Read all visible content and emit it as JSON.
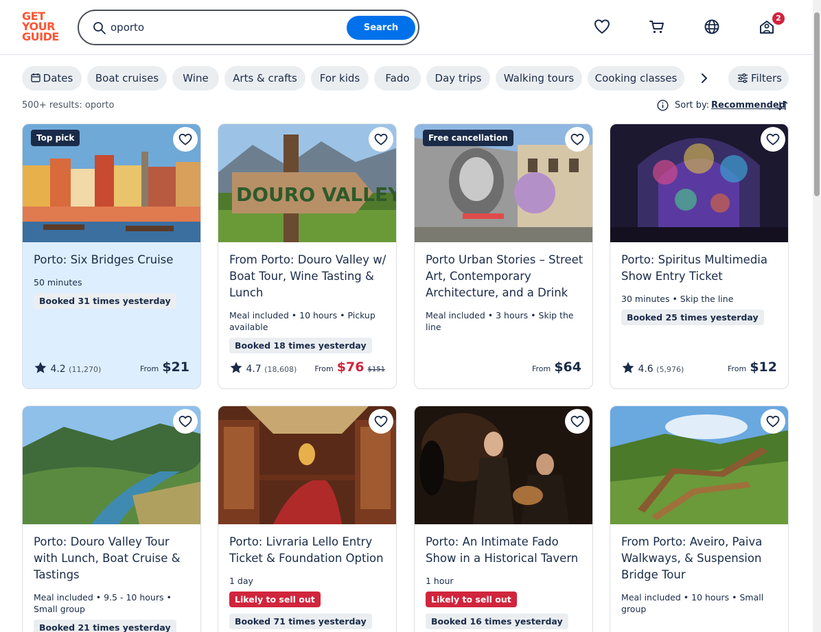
{
  "header": {
    "logo_lines": [
      "GET",
      "YOUR",
      "GUIDE"
    ],
    "search_value": "oporto",
    "search_button": "Search",
    "cart_badge": "2"
  },
  "chips": [
    "Dates",
    "Boat cruises",
    "Wine",
    "Arts & crafts",
    "For kids",
    "Fado",
    "Day trips",
    "Walking tours",
    "Cooking classes"
  ],
  "filters_label": "Filters",
  "results_text": "500+ results: oporto",
  "sort": {
    "label": "Sort by:",
    "value": "Recommended"
  },
  "cards": [
    {
      "tag": "Top pick",
      "title": "Porto: Six Bridges Cruise",
      "meta": "50 minutes",
      "booked": "Booked 31 times yesterday",
      "rating": "4.2",
      "reviews": "(11,270)",
      "from": "From",
      "price": "$21"
    },
    {
      "title": "From Porto: Douro Valley w/ Boat Tour, Wine Tasting & Lunch",
      "meta": "Meal included • 10 hours • Pickup available",
      "booked": "Booked 18 times yesterday",
      "rating": "4.7",
      "reviews": "(18,608)",
      "from": "From",
      "price": "$76",
      "original_price": "$151"
    },
    {
      "tag": "Free cancellation",
      "title": "Porto Urban Stories – Street Art, Contemporary Architecture, and a Drink",
      "meta": "Meal included • 3 hours • Skip the line",
      "from": "From",
      "price": "$64"
    },
    {
      "title": "Porto: Spiritus Multimedia Show Entry Ticket",
      "meta": "30 minutes • Skip the line",
      "booked": "Booked 25 times yesterday",
      "rating": "4.6",
      "reviews": "(5,976)",
      "from": "From",
      "price": "$12"
    },
    {
      "title": "Porto: Douro Valley Tour with Lunch, Boat Cruise & Tastings",
      "meta": "Meal included • 9.5 - 10 hours • Small group",
      "booked": "Booked 21 times yesterday"
    },
    {
      "title": "Porto: Livraria Lello Entry Ticket & Foundation Option",
      "meta": "1 day",
      "sellout": "Likely to sell out",
      "booked": "Booked 71 times yesterday"
    },
    {
      "title": "Porto: An Intimate Fado Show in a Historical Tavern",
      "meta": "1 hour",
      "sellout": "Likely to sell out",
      "booked": "Booked 16 times yesterday"
    },
    {
      "title": "From Porto: Aveiro, Paiva Walkways, & Suspension Bridge Tour",
      "meta": "Meal included • 10 hours • Small group"
    }
  ],
  "colors": {
    "brand": "#ff5533",
    "primary_button": "#0071eb",
    "sale_price": "#d0253d",
    "highlight_card": "#ddeefe",
    "text": "#1a2b49"
  },
  "icons": [
    "search-icon",
    "heart-icon",
    "cart-icon",
    "globe-icon",
    "account-icon",
    "calendar-icon",
    "chevron-right-icon",
    "filters-icon",
    "info-icon",
    "sort-icon",
    "star-icon"
  ]
}
